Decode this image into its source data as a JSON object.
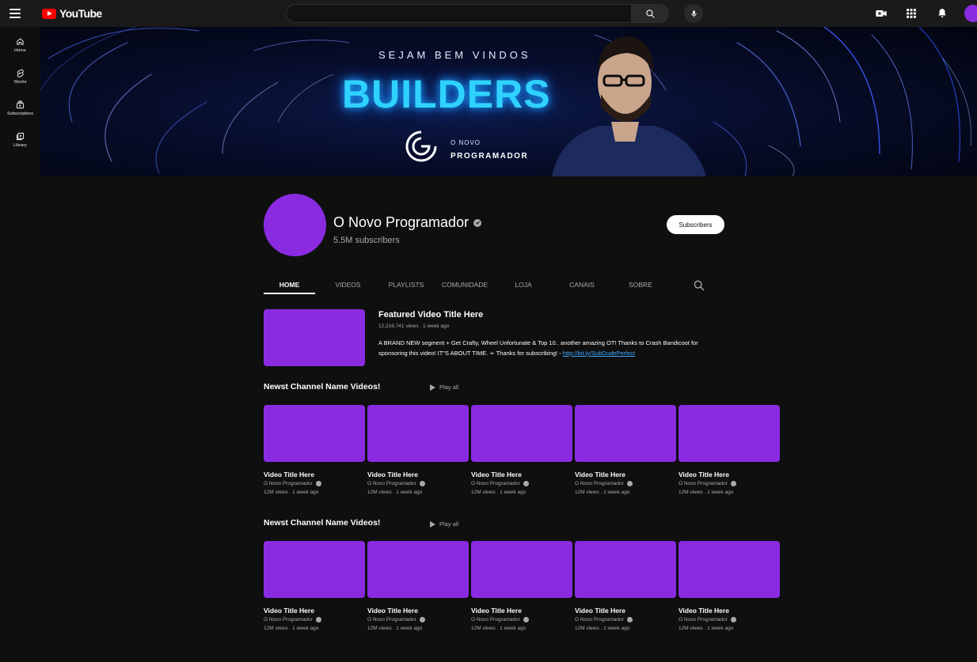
{
  "header": {
    "logo_text": "YouTube",
    "search_placeholder": ""
  },
  "sidebar": {
    "items": [
      {
        "label": "Home",
        "icon": "home-icon"
      },
      {
        "label": "Shorts",
        "icon": "shorts-icon"
      },
      {
        "label": "Subscriptions",
        "icon": "subscriptions-icon"
      },
      {
        "label": "Library",
        "icon": "library-icon"
      }
    ]
  },
  "banner": {
    "tagline": "SEJAM BEM VINDOS",
    "title": "BUILDERS",
    "brand_small": "O NOVO",
    "brand_big": "PROGRAMADOR"
  },
  "channel": {
    "name": "O Novo Programador",
    "subscribers": "5.5M subscribers",
    "subscribe_label": "Subscribers"
  },
  "tabs": [
    "HOME",
    "VIDEOS",
    "PLAYLISTS",
    "COMUNIDADE",
    "LOJA",
    "CANAIS",
    "SOBRE"
  ],
  "featured": {
    "title": "Featured Video Title Here",
    "meta": "12,216,741 views . 1 week ago",
    "description": "A BRAND NEW segment + Get Crafty, Wheel Unfortunate & Top 10.. another amazing OT! Thanks to Crash Bandicoot for sponsoring this video! IT\"S ABOUT TIME. ➢ Thanks for subscribing! - ",
    "link": "http://bit.ly/SubDudePerfect"
  },
  "sections": [
    {
      "title": "Newst Channel Name Videos!",
      "play_all": "Play all",
      "videos": [
        {
          "title": "Video Title Here",
          "channel": "O Novo Programador",
          "meta": "12M views . 1 week ago"
        },
        {
          "title": "Video Title Here",
          "channel": "O Novo Programador",
          "meta": "12M views . 1 week ago"
        },
        {
          "title": "Video Title Here",
          "channel": "O Novo Programador",
          "meta": "12M views . 1 week ago"
        },
        {
          "title": "Video Title Here",
          "channel": "O Novo Programador",
          "meta": "12M views . 1 week ago"
        },
        {
          "title": "Video Title Here",
          "channel": "O Novo Programador",
          "meta": "12M views . 1 week ago"
        }
      ]
    },
    {
      "title": "Newst Channel Name Videos!",
      "play_all": "Play all",
      "videos": [
        {
          "title": "Video Title Here",
          "channel": "O Novo Programador",
          "meta": "12M views . 1 week ago"
        },
        {
          "title": "Video Title Here",
          "channel": "O Novo Programador",
          "meta": "12M views . 1 week ago"
        },
        {
          "title": "Video Title Here",
          "channel": "O Novo Programador",
          "meta": "12M views . 1 week ago"
        },
        {
          "title": "Video Title Here",
          "channel": "O Novo Programador",
          "meta": "12M views . 1 week ago"
        },
        {
          "title": "Video Title Here",
          "channel": "O Novo Programador",
          "meta": "12M views . 1 week ago"
        }
      ]
    }
  ],
  "colors": {
    "background": "#0f0f0f",
    "accent_purple": "#8a2be2",
    "youtube_red": "#ff0000",
    "link_blue": "#3ea6ff",
    "banner_glow": "#2fd2ff"
  }
}
